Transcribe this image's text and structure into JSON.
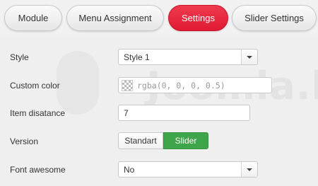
{
  "tabs": [
    {
      "label": "Module",
      "active": false
    },
    {
      "label": "Menu Assignment",
      "active": false
    },
    {
      "label": "Settings",
      "active": true
    },
    {
      "label": "Slider Settings",
      "active": false
    }
  ],
  "form": {
    "style": {
      "label": "Style",
      "value": "Style 1"
    },
    "custom_color": {
      "label": "Custom color",
      "value": "rgba(0, 0, 0, 0.5)"
    },
    "item_distance": {
      "label": "Item disatance",
      "value": "7"
    },
    "version": {
      "label": "Version",
      "options": [
        "Standart",
        "Slider"
      ],
      "selected": "Slider"
    },
    "font_awesome": {
      "label": "Font awesome",
      "value": "No"
    }
  },
  "watermark": "Joomla.b",
  "colors": {
    "active_tab": "#e8243b",
    "toggle_on": "#3fa54a"
  }
}
